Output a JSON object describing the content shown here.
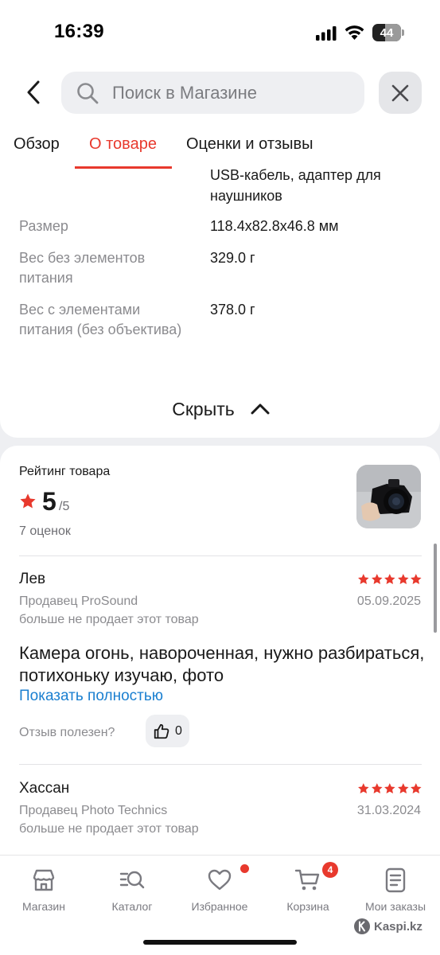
{
  "status_bar": {
    "time": "16:39",
    "battery": "44"
  },
  "header": {
    "ghost_text": "",
    "search_placeholder": "Поиск в Магазине"
  },
  "tabs": [
    {
      "label": "Обзор",
      "active": false
    },
    {
      "label": "О товаре",
      "active": true
    },
    {
      "label": "Оценки и отзывы",
      "active": false
    }
  ],
  "specs": {
    "top_value": "USB-кабель, адаптер для наушников",
    "rows": [
      {
        "label": "Размер",
        "value": "118.4x82.8x46.8 мм"
      },
      {
        "label": "Вес без элементов питания",
        "value": "329.0 г"
      },
      {
        "label": "Вес с элементами питания (без объектива)",
        "value": "378.0 г"
      }
    ],
    "hide_label": "Скрыть"
  },
  "rating": {
    "title": "Рейтинг товара",
    "value": "5",
    "max": "/5",
    "count": "7 оценок",
    "accent_color": "#e8392d"
  },
  "reviews": [
    {
      "name": "Лев",
      "stars": 5,
      "seller": "Продавец ProSound",
      "date": "05.09.2025",
      "seller_status": "больше не продает этот товар",
      "text": "Камера огонь, навороченная, нужно разбираться, потихоньку изучаю, фото",
      "show_more": "Показать полностью",
      "helpful_label": "Отзыв полезен?",
      "likes": "0"
    },
    {
      "name": "Хассан",
      "stars": 5,
      "seller": "Продавец Photo Technics",
      "date": "31.03.2024",
      "seller_status": "больше не продает этот товар"
    }
  ],
  "tabbar": {
    "items": [
      {
        "label": "Магазин",
        "icon": "store-icon"
      },
      {
        "label": "Каталог",
        "icon": "catalog-search-icon"
      },
      {
        "label": "Избранное",
        "icon": "heart-icon"
      },
      {
        "label": "Корзина",
        "icon": "cart-icon"
      },
      {
        "label": "Мои заказы",
        "icon": "orders-icon"
      }
    ],
    "cart_badge": "4"
  },
  "watermark": "Kaspi.kz"
}
